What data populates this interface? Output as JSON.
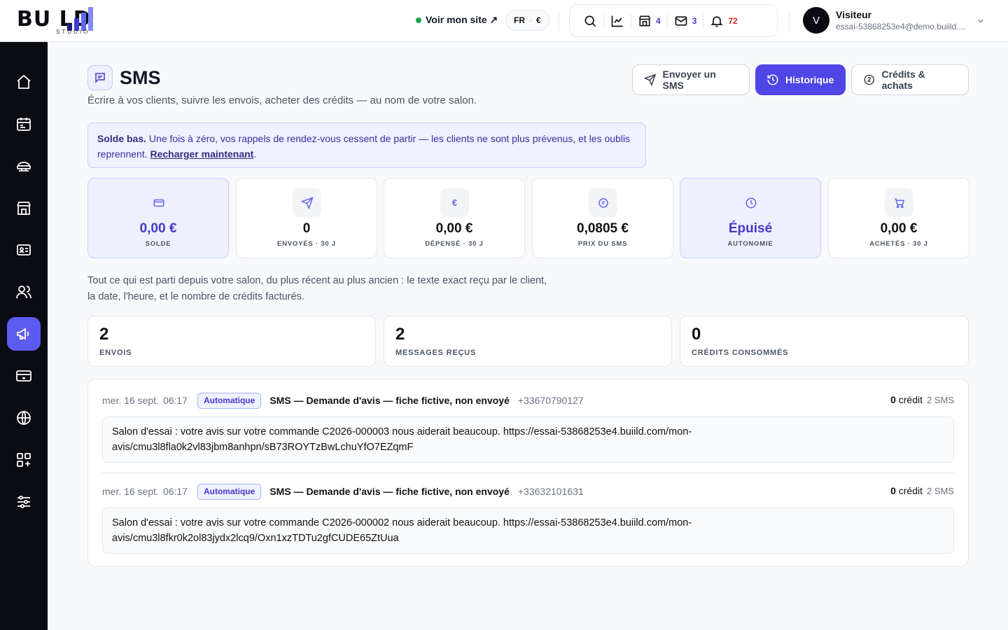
{
  "brand": {
    "logo_text": "BU  LD",
    "logo_sub": "STUDIO"
  },
  "header": {
    "site_link": "Voir mon site ↗",
    "lang": "FR",
    "currency": "€",
    "shop_count": "4",
    "mail_count": "3",
    "notif_count": "72",
    "user": {
      "initial": "V",
      "name": "Visiteur",
      "email": "essai-53868253e4@demo.buiild...."
    }
  },
  "sidebar": {
    "items": [
      "home-icon",
      "calendar-icon",
      "services-icon",
      "store-icon",
      "contact-card-icon",
      "users-icon",
      "megaphone-icon",
      "card-icon",
      "globe-icon",
      "apps-icon",
      "sliders-icon"
    ],
    "active": "megaphone-icon"
  },
  "page": {
    "title": "SMS",
    "subtitle": "Écrire à vos clients, suivre les envois, acheter des crédits — au nom de votre salon.",
    "buttons": {
      "send": "Envoyer un SMS",
      "history": "Historique",
      "credits": "Crédits & achats"
    }
  },
  "alert": {
    "bold": "Solde bas.",
    "text": " Une fois à zéro, vos rappels de rendez-vous cessent de partir — les clients ne sont plus prévenus, et les oublis reprennent. ",
    "link": "Recharger maintenant",
    "end": "."
  },
  "stats": [
    {
      "value": "0,00 €",
      "label": "SOLDE",
      "icon": "card-icon"
    },
    {
      "value": "0",
      "label": "ENVOYÉS · 30 J",
      "icon": "send-icon"
    },
    {
      "value": "0,00 €",
      "label": "DÉPENSÉ · 30 J",
      "icon": "euro-icon"
    },
    {
      "value": "0,0805 €",
      "label": "PRIX DU SMS",
      "icon": "message-icon"
    },
    {
      "value": "Épuisé",
      "label": "AUTONOMIE",
      "icon": "clock-icon"
    },
    {
      "value": "0,00 €",
      "label": "ACHETÉS · 30 J",
      "icon": "cart-icon"
    }
  ],
  "history": {
    "description_line1": "Tout ce qui est parti depuis votre salon, du plus récent au plus ancien : le texte exact reçu par le client,",
    "description_line2": "la date, l'heure, et le nombre de crédits facturés.",
    "kpis": [
      {
        "value": "2",
        "label": "ENVOIS"
      },
      {
        "value": "2",
        "label": "MESSAGES REÇUS"
      },
      {
        "value": "0",
        "label": "CRÉDITS CONSOMMÉS"
      }
    ],
    "rows": [
      {
        "date": "mer. 16 sept.",
        "time": "06:17",
        "badge": "Automatique",
        "title": "SMS — Demande d'avis — fiche fictive, non envoyé",
        "phone": "+33670790127",
        "credits": "0",
        "credit_word": "crédit",
        "sms": "2 SMS",
        "message_line1": "Salon d'essai : votre avis sur votre commande C2026-000003 nous aiderait beaucoup. https://essai-53868253e4.buiild.com/mon-",
        "message_line2": "avis/cmu3l8fla0k2vl83jbm8anhpn/sB73ROYTzBwLchuYfO7EZqmF"
      },
      {
        "date": "mer. 16 sept.",
        "time": "06:17",
        "badge": "Automatique",
        "title": "SMS — Demande d'avis — fiche fictive, non envoyé",
        "phone": "+33632101631",
        "credits": "0",
        "credit_word": "crédit",
        "sms": "2 SMS",
        "message_line1": "Salon d'essai : votre avis sur votre commande C2026-000002 nous aiderait beaucoup. https://essai-53868253e4.buiild.com/mon-",
        "message_line2": "avis/cmu3l8fkr0k2ol83jydx2lcq9/Oxn1xzTDTu2gfCUDE65ZtUua"
      }
    ]
  }
}
